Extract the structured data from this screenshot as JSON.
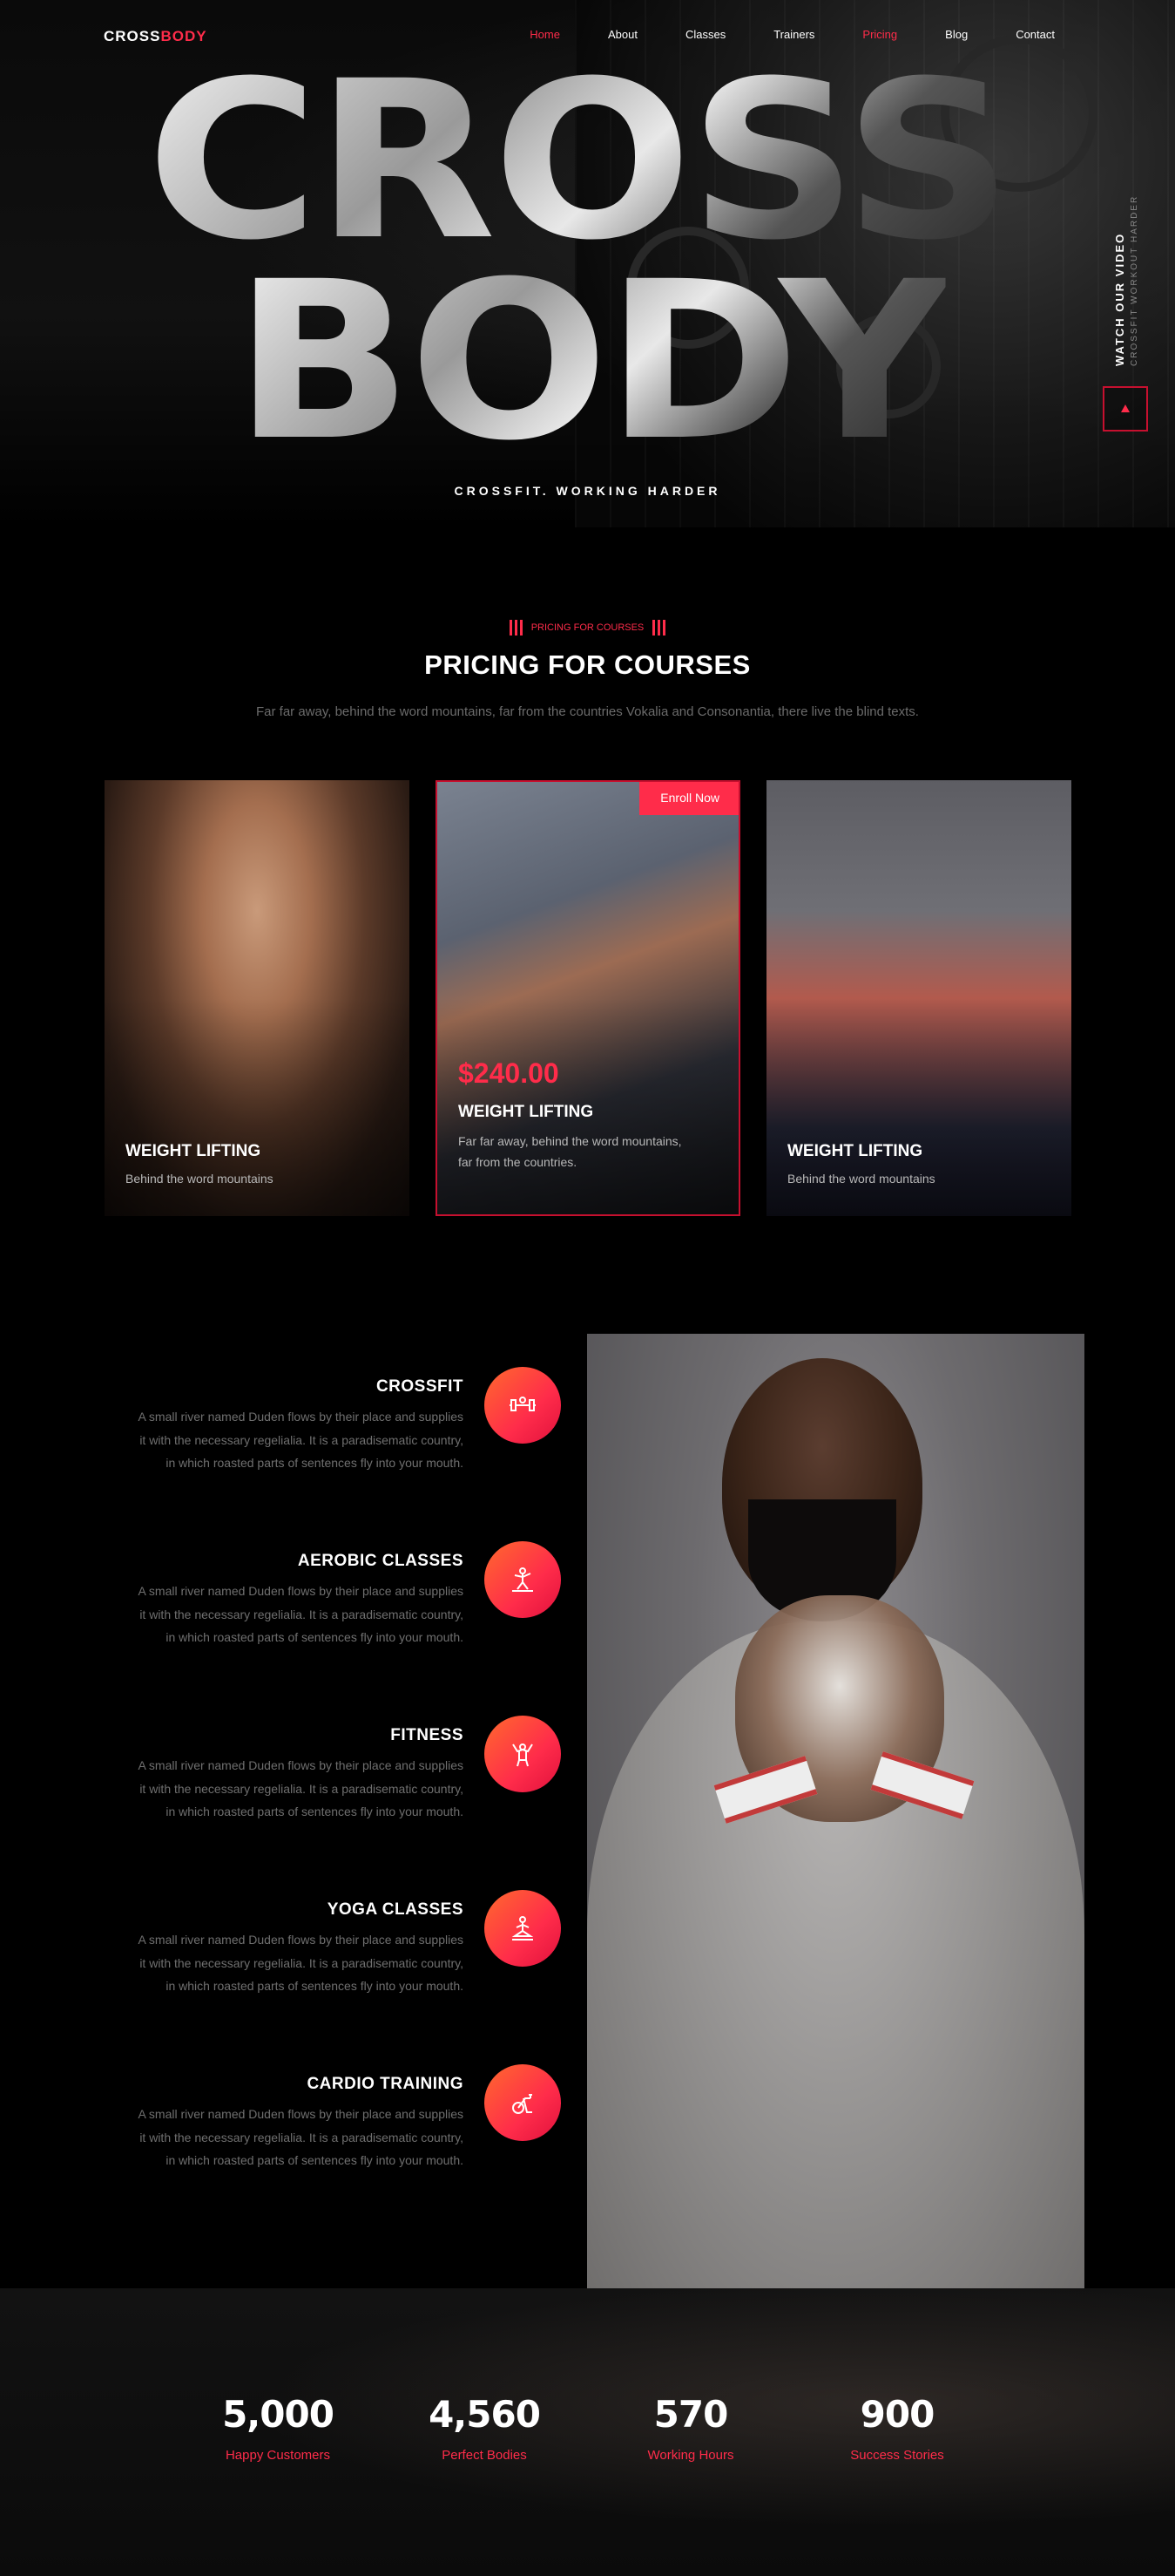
{
  "brand": {
    "part1": "CROSS",
    "part2": "BODY"
  },
  "nav": {
    "items": [
      {
        "label": "Home",
        "active": true
      },
      {
        "label": "About",
        "active": false
      },
      {
        "label": "Classes",
        "active": false
      },
      {
        "label": "Trainers",
        "active": false
      },
      {
        "label": "Pricing",
        "active": true
      },
      {
        "label": "Blog",
        "active": false
      },
      {
        "label": "Contact",
        "active": false
      }
    ]
  },
  "hero": {
    "word1": "CROSS",
    "word2": "BODY",
    "tagline": "CROSSFIT. WORKING HARDER",
    "watch_title": "WATCH OUR VIDEO",
    "watch_sub": "CROSSFIT WORKOUT HARDER",
    "play_icon": "play-icon"
  },
  "pricing": {
    "tag": "PRICING FOR COURSES",
    "title": "PRICING FOR COURSES",
    "subtitle": "Far far away, behind the word mountains, far from the countries Vokalia and Consonantia, there live the blind texts.",
    "cards": [
      {
        "title": "WEIGHT LIFTING",
        "desc": "Behind the word mountains"
      },
      {
        "title": "WEIGHT LIFTING",
        "price": "$240.00",
        "desc": "Far far away, behind the word mountains, far from the countries.",
        "button": "Enroll Now"
      },
      {
        "title": "WEIGHT LIFTING",
        "desc": "Behind the word mountains"
      }
    ]
  },
  "services": [
    {
      "title": "CROSSFIT",
      "desc": "A small river named Duden flows by their place and supplies it with the necessary regelialia. It is a paradisematic country, in which roasted parts of sentences fly into your mouth.",
      "icon": "dumbbell-icon"
    },
    {
      "title": "AEROBIC CLASSES",
      "desc": "A small river named Duden flows by their place and supplies it with the necessary regelialia. It is a paradisematic country, in which roasted parts of sentences fly into your mouth.",
      "icon": "aerobic-icon"
    },
    {
      "title": "FITNESS",
      "desc": "A small river named Duden flows by their place and supplies it with the necessary regelialia. It is a paradisematic country, in which roasted parts of sentences fly into your mouth.",
      "icon": "fitness-icon"
    },
    {
      "title": "YOGA CLASSES",
      "desc": "A small river named Duden flows by their place and supplies it with the necessary regelialia. It is a paradisematic country, in which roasted parts of sentences fly into your mouth.",
      "icon": "yoga-icon"
    },
    {
      "title": "CARDIO TRAINING",
      "desc": "A small river named Duden flows by their place and supplies it with the necessary regelialia. It is a paradisematic country, in which roasted parts of sentences fly into your mouth.",
      "icon": "exercise-bike-icon"
    }
  ],
  "counters": [
    {
      "value": "5,000",
      "label": "Happy Customers"
    },
    {
      "value": "4,560",
      "label": "Perfect Bodies"
    },
    {
      "value": "570",
      "label": "Working Hours"
    },
    {
      "value": "900",
      "label": "Success Stories"
    }
  ],
  "colors": {
    "accent": "#ff2c4a",
    "accent_dark": "#c6102f",
    "background": "#000000",
    "muted_text": "#6f6f6f"
  }
}
